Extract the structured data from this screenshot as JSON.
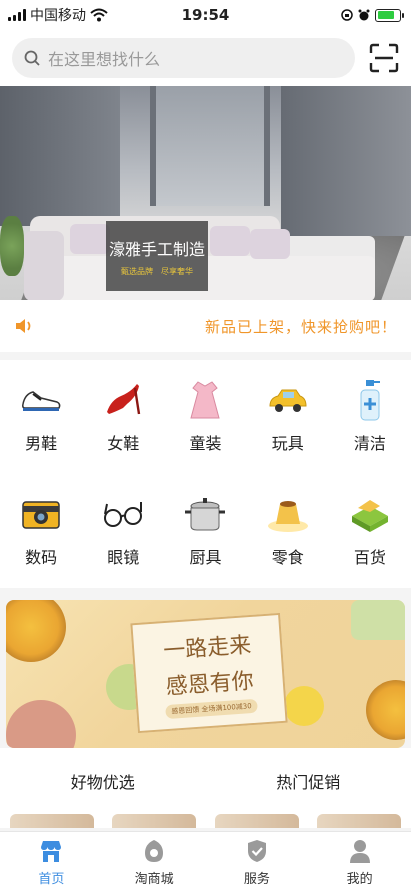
{
  "status_bar": {
    "carrier": "中国移动",
    "time": "19:54",
    "battery_level": 0.8
  },
  "search": {
    "placeholder": "在这里想找什么"
  },
  "banner": {
    "title": "濠雅手工制造",
    "subtitle": "甄选品牌　尽享奢华"
  },
  "notice": {
    "text": "新品已上架，快来抢购吧！"
  },
  "categories": [
    {
      "label": "男鞋",
      "icon": "sneaker-icon"
    },
    {
      "label": "女鞋",
      "icon": "high-heel-icon"
    },
    {
      "label": "童装",
      "icon": "kids-dress-icon"
    },
    {
      "label": "玩具",
      "icon": "toy-car-icon"
    },
    {
      "label": "清洁",
      "icon": "sanitizer-bottle-icon"
    },
    {
      "label": "数码",
      "icon": "camera-icon"
    },
    {
      "label": "眼镜",
      "icon": "glasses-icon"
    },
    {
      "label": "厨具",
      "icon": "cooking-pot-icon"
    },
    {
      "label": "零食",
      "icon": "pudding-icon"
    },
    {
      "label": "百货",
      "icon": "soap-icon"
    }
  ],
  "promo": {
    "line1": "一路走来",
    "line2": "感恩有你",
    "badge": "感恩回馈 全场满100减30"
  },
  "sections": {
    "left": "好物优选",
    "right": "热门促销"
  },
  "tab_bar": [
    {
      "label": "首页",
      "icon": "shop-home-icon",
      "active": true
    },
    {
      "label": "淘商城",
      "icon": "mall-bag-icon",
      "active": false
    },
    {
      "label": "服务",
      "icon": "shield-check-icon",
      "active": false
    },
    {
      "label": "我的",
      "icon": "user-icon",
      "active": false
    }
  ],
  "colors": {
    "accent": "#3d8de0",
    "notice": "#f0962a",
    "search_bg": "#efefef"
  }
}
